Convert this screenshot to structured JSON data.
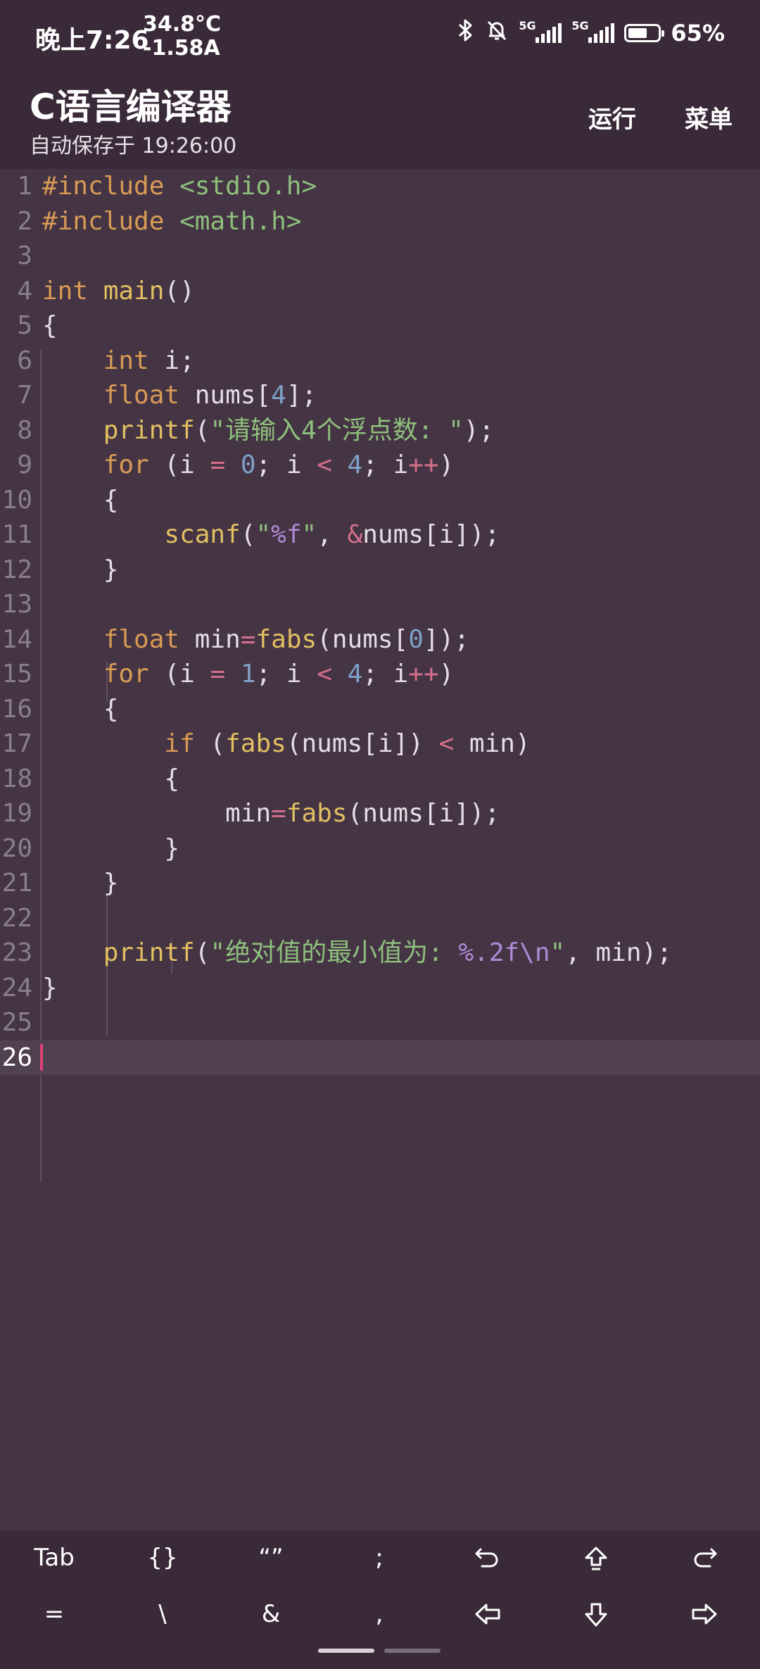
{
  "status_bar": {
    "time": "晚上7:26",
    "temperature": "34.8°C",
    "current": "-1.58A",
    "sim1_label": "5G",
    "sim2_label": "5G",
    "battery_percent": "65%",
    "battery_level": 0.65
  },
  "app_bar": {
    "title": "C语言编译器",
    "subtitle": "自动保存于 19:26:00",
    "run_label": "运行",
    "menu_label": "菜单"
  },
  "editor": {
    "current_line": 26,
    "lines": [
      {
        "n": "1"
      },
      {
        "n": "2"
      },
      {
        "n": "3"
      },
      {
        "n": "4"
      },
      {
        "n": "5"
      },
      {
        "n": "6"
      },
      {
        "n": "7"
      },
      {
        "n": "8"
      },
      {
        "n": "9"
      },
      {
        "n": "10"
      },
      {
        "n": "11"
      },
      {
        "n": "12"
      },
      {
        "n": "13"
      },
      {
        "n": "14"
      },
      {
        "n": "15"
      },
      {
        "n": "16"
      },
      {
        "n": "17"
      },
      {
        "n": "18"
      },
      {
        "n": "19"
      },
      {
        "n": "20"
      },
      {
        "n": "21"
      },
      {
        "n": "22"
      },
      {
        "n": "23"
      },
      {
        "n": "24"
      },
      {
        "n": "25"
      },
      {
        "n": "26"
      }
    ],
    "code": {
      "l1_dir": "#include",
      "l1_hdr": "<stdio.h>",
      "l2_dir": "#include",
      "l2_hdr": "<math.h>",
      "l4_kw": "int",
      "l4_fn": "main",
      "l4_rest": "()",
      "l5": "{",
      "l6_kw": "int",
      "l6_rest": " i;",
      "l7_kw": "float",
      "l7_a": " nums[",
      "l7_num": "4",
      "l7_b": "];",
      "l8_fn": "printf",
      "l8_open": "(",
      "l8_str": "\"请输入4个浮点数: \"",
      "l8_close": ");",
      "l9_kw": "for",
      "l9_a": " (i ",
      "l9_op1": "=",
      "l9_b": " ",
      "l9_n1": "0",
      "l9_c": "; i ",
      "l9_op2": "<",
      "l9_d": " ",
      "l9_n2": "4",
      "l9_e": "; i",
      "l9_op3": "++",
      "l9_f": ")",
      "l10": "{",
      "l11_fn": "scanf",
      "l11_open": "(",
      "l11_q1": "\"",
      "l11_fmt": "%f",
      "l11_q2": "\"",
      "l11_comma": ", ",
      "l11_amp": "&",
      "l11_rest": "nums[i]);",
      "l12": "}",
      "l14_kw": "float",
      "l14_a": " min",
      "l14_op": "=",
      "l14_fn": "fabs",
      "l14_b": "(nums[",
      "l14_num": "0",
      "l14_c": "]);",
      "l15_kw": "for",
      "l15_a": " (i ",
      "l15_op1": "=",
      "l15_b": " ",
      "l15_n1": "1",
      "l15_c": "; i ",
      "l15_op2": "<",
      "l15_d": " ",
      "l15_n2": "4",
      "l15_e": "; i",
      "l15_op3": "++",
      "l15_f": ")",
      "l16": "{",
      "l17_kw": "if",
      "l17_a": " (",
      "l17_fn": "fabs",
      "l17_b": "(nums[i]) ",
      "l17_op": "<",
      "l17_c": " min)",
      "l18": "{",
      "l19_a": "min",
      "l19_op": "=",
      "l19_fn": "fabs",
      "l19_b": "(nums[i]);",
      "l20": "}",
      "l21": "}",
      "l23_fn": "printf",
      "l23_open": "(",
      "l23_str1": "\"绝对值的最小值为: ",
      "l23_fmt": "%.2f\\n",
      "l23_str2": "\"",
      "l23_rest": ", min);",
      "l24": "}"
    }
  },
  "extra_keys": {
    "row1": {
      "tab": "Tab",
      "braces": "{}",
      "quotes": "“”",
      "semicolon": ";",
      "undo_icon": "undo-icon",
      "shift_icon": "arrow-up-icon",
      "redo_icon": "redo-icon"
    },
    "row2": {
      "equals": "=",
      "backslash": "\\",
      "ampersand": "&",
      "comma": ",",
      "left_icon": "arrow-left-icon",
      "down_icon": "arrow-down-icon",
      "right_icon": "arrow-right-icon"
    }
  },
  "colors": {
    "background": "#453444",
    "bar": "#3a2a39",
    "keyword": "#d89b55",
    "function": "#e2c062",
    "string": "#8ec07c",
    "number": "#7fa1c8",
    "operator": "#d36f8b",
    "caret": "#e0427a"
  }
}
